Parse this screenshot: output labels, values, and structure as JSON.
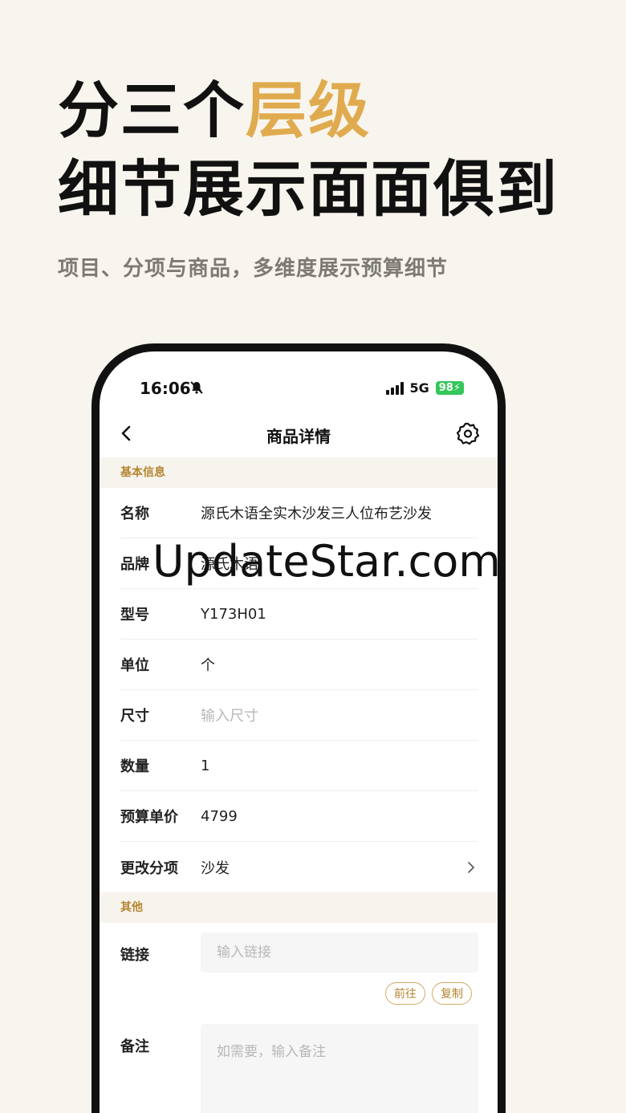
{
  "headline": {
    "line1_plain": "分三个",
    "line1_accent": "层级",
    "line2": "细节展示面面俱到"
  },
  "subhead": "项目、分项与商品，多维度展示预算细节",
  "colors": {
    "accent": "#e0ab4e",
    "section": "#b4852f",
    "battery": "#34c759",
    "background": "#f8f5ee"
  },
  "status": {
    "time": "16:06",
    "network": "5G",
    "battery": "98"
  },
  "nav": {
    "title": "商品详情"
  },
  "basic": {
    "header": "基本信息",
    "rows": [
      {
        "label": "名称",
        "value": "源氏木语全实木沙发三人位布艺沙发"
      },
      {
        "label": "品牌",
        "value": "源氏木语"
      },
      {
        "label": "型号",
        "value": "Y173H01"
      },
      {
        "label": "单位",
        "value": "个"
      },
      {
        "label": "尺寸",
        "placeholder": "输入尺寸"
      },
      {
        "label": "数量",
        "value": "1"
      },
      {
        "label": "预算单价",
        "value": "4799"
      },
      {
        "label": "更改分项",
        "value": "沙发"
      }
    ]
  },
  "other": {
    "header": "其他",
    "link_label": "链接",
    "link_placeholder": "输入链接",
    "goto_button": "前往",
    "copy_button": "复制",
    "remark_label": "备注",
    "remark_placeholder": "如需要，输入备注"
  },
  "watermark": "UpdateStar.com"
}
